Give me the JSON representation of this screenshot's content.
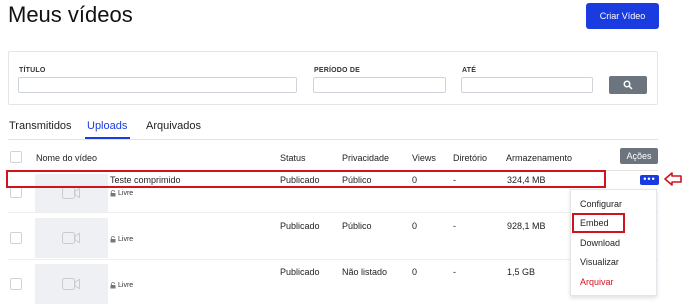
{
  "page": {
    "title": "Meus vídeos"
  },
  "header": {
    "create_button": "Criar Vídeo"
  },
  "filters": {
    "titulo_label": "TÍTULO",
    "periodo_label": "PERÍODO DE",
    "ate_label": "ATÉ",
    "search_icon": "search-icon"
  },
  "tabs": [
    {
      "label": "Transmitidos"
    },
    {
      "label": "Uploads",
      "active": true
    },
    {
      "label": "Arquivados"
    }
  ],
  "table": {
    "headers": {
      "nome": "Nome do vídeo",
      "status": "Status",
      "privacidade": "Privacidade",
      "views": "Views",
      "diretorio": "Diretório",
      "armazenamento": "Armazenamento"
    },
    "actions_button": "Ações",
    "rows": [
      {
        "name": "Teste comprimido",
        "status": "Publicado",
        "privacy": "Público",
        "views": "0",
        "directory": "-",
        "storage": "324,4 MB",
        "visibility": "Livre"
      },
      {
        "name": "",
        "status": "Publicado",
        "privacy": "Público",
        "views": "0",
        "directory": "-",
        "storage": "928,1 MB",
        "visibility": "Livre"
      },
      {
        "name": "",
        "status": "Publicado",
        "privacy": "Não listado",
        "views": "0",
        "directory": "-",
        "storage": "1,5 GB",
        "visibility": "Livre"
      }
    ]
  },
  "row_menu": {
    "items": [
      "Configurar",
      "Embed",
      "Download",
      "Visualizar",
      "Arquivar"
    ]
  },
  "colors": {
    "primary": "#1a3bdf",
    "annotation_red": "#d0141e",
    "secondary": "#6c757d"
  }
}
